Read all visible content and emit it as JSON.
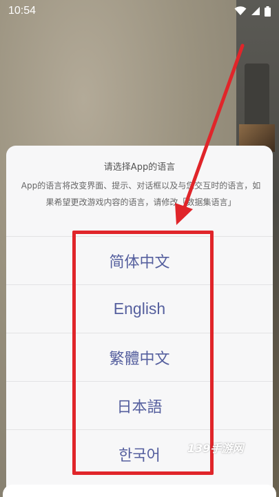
{
  "status_bar": {
    "time": "10:54",
    "icons": [
      "wifi-icon",
      "signal-icon",
      "battery-icon"
    ]
  },
  "dialog": {
    "title": "请选择App的语言",
    "message": "App的语言将改变界面、提示、对话框以及与您交互时的语言，如果希望更改游戏内容的语言，请修改「数据集语言」",
    "options": [
      {
        "label": "简体中文"
      },
      {
        "label": "English"
      },
      {
        "label": "繁體中文"
      },
      {
        "label": "日本語"
      },
      {
        "label": "한국어"
      }
    ]
  },
  "annotation": {
    "highlight_color": "#e0252a"
  },
  "watermark": {
    "text": "139手游网"
  },
  "colors": {
    "option_text": "#555f9e",
    "dialog_bg": "#f7f7f8",
    "divider": "#e2e2e4"
  }
}
